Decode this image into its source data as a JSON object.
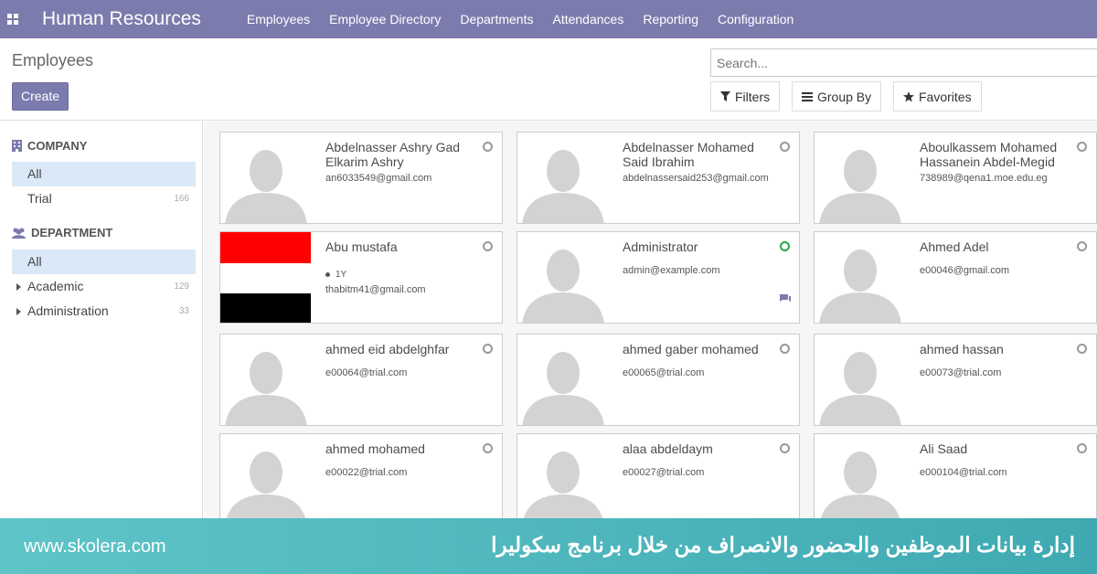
{
  "topbar": {
    "app_title": "Human Resources",
    "menu": [
      "Employees",
      "Employee Directory",
      "Departments",
      "Attendances",
      "Reporting",
      "Configuration"
    ],
    "color": "#7c7bad"
  },
  "control": {
    "page_title": "Employees",
    "create_label": "Create",
    "search_placeholder": "Search...",
    "filters_label": "Filters",
    "groupby_label": "Group By",
    "favorites_label": "Favorites"
  },
  "sidebar": {
    "company_heading": "COMPANY",
    "company_items": [
      {
        "label": "All",
        "count": ""
      },
      {
        "label": "Trial",
        "count": "166"
      }
    ],
    "department_heading": "DEPARTMENT",
    "department_items": [
      {
        "label": "All",
        "count": ""
      },
      {
        "label": "Academic",
        "count": "129"
      },
      {
        "label": "Administration",
        "count": "33"
      }
    ]
  },
  "employees": [
    {
      "name": "Abdelnasser Ashry Gad Elkarim Ashry",
      "email": "an6033549@gmail.com",
      "status": "offline"
    },
    {
      "name": "Abdelnasser Mohamed Said Ibrahim",
      "email": "abdelnassersaid253@gmail.com",
      "status": "offline"
    },
    {
      "name": "Aboulkassem Mohamed Hassanein Abdel-Megid",
      "email": "738989@qena1.moe.edu.eg",
      "status": "offline"
    },
    {
      "name": "Abu mustafa",
      "email": "thabitm41@gmail.com",
      "status": "offline",
      "tag": "1Y",
      "image": "flag"
    },
    {
      "name": "Administrator",
      "email": "admin@example.com",
      "status": "online",
      "chat": true
    },
    {
      "name": "Ahmed Adel",
      "email": "e00046@gmail.com",
      "status": "offline"
    },
    {
      "name": "ahmed eid abdelghfar",
      "email": "e00064@trial.com",
      "status": "offline"
    },
    {
      "name": "ahmed gaber mohamed",
      "email": "e00065@trial.com",
      "status": "offline"
    },
    {
      "name": "ahmed hassan",
      "email": "e00073@trial.com",
      "status": "offline"
    },
    {
      "name": "ahmed mohamed",
      "email": "e00022@trial.com",
      "status": "offline"
    },
    {
      "name": "alaa abdeldaym",
      "email": "e00027@trial.com",
      "status": "offline"
    },
    {
      "name": "Ali Saad",
      "email": "e000104@trial.com",
      "status": "offline"
    }
  ],
  "banner": {
    "url": "www.skolera.com",
    "title": "إدارة بيانات الموظفين والحضور والانصراف من خلال برنامج سكوليرا"
  }
}
